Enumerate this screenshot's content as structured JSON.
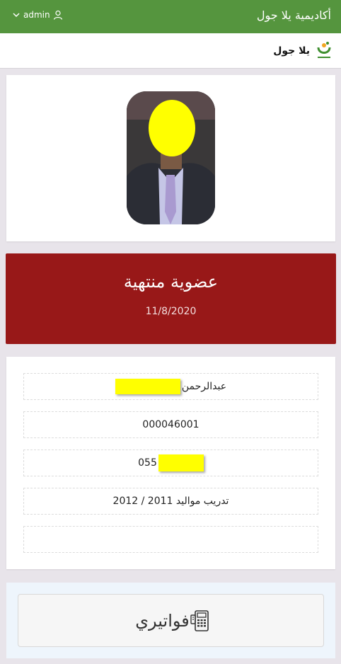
{
  "header": {
    "user_label": "admin",
    "title": "أكاديمية يلا جول"
  },
  "brand": {
    "name": "يلا جول"
  },
  "membership": {
    "status": "عضوية منتهية",
    "date": "11/8/2020",
    "status_color": "#981818"
  },
  "profile": {
    "name_prefix": "عبدالرحمن",
    "member_id": "000046001",
    "phone_prefix": "055",
    "program": "تدريب مواليد 2011 / 2012",
    "extra": ""
  },
  "invoices": {
    "label": "فواتيري"
  },
  "colors": {
    "topbar": "#55953e",
    "background": "#e8e4ea",
    "redaction": "#ffff00"
  }
}
